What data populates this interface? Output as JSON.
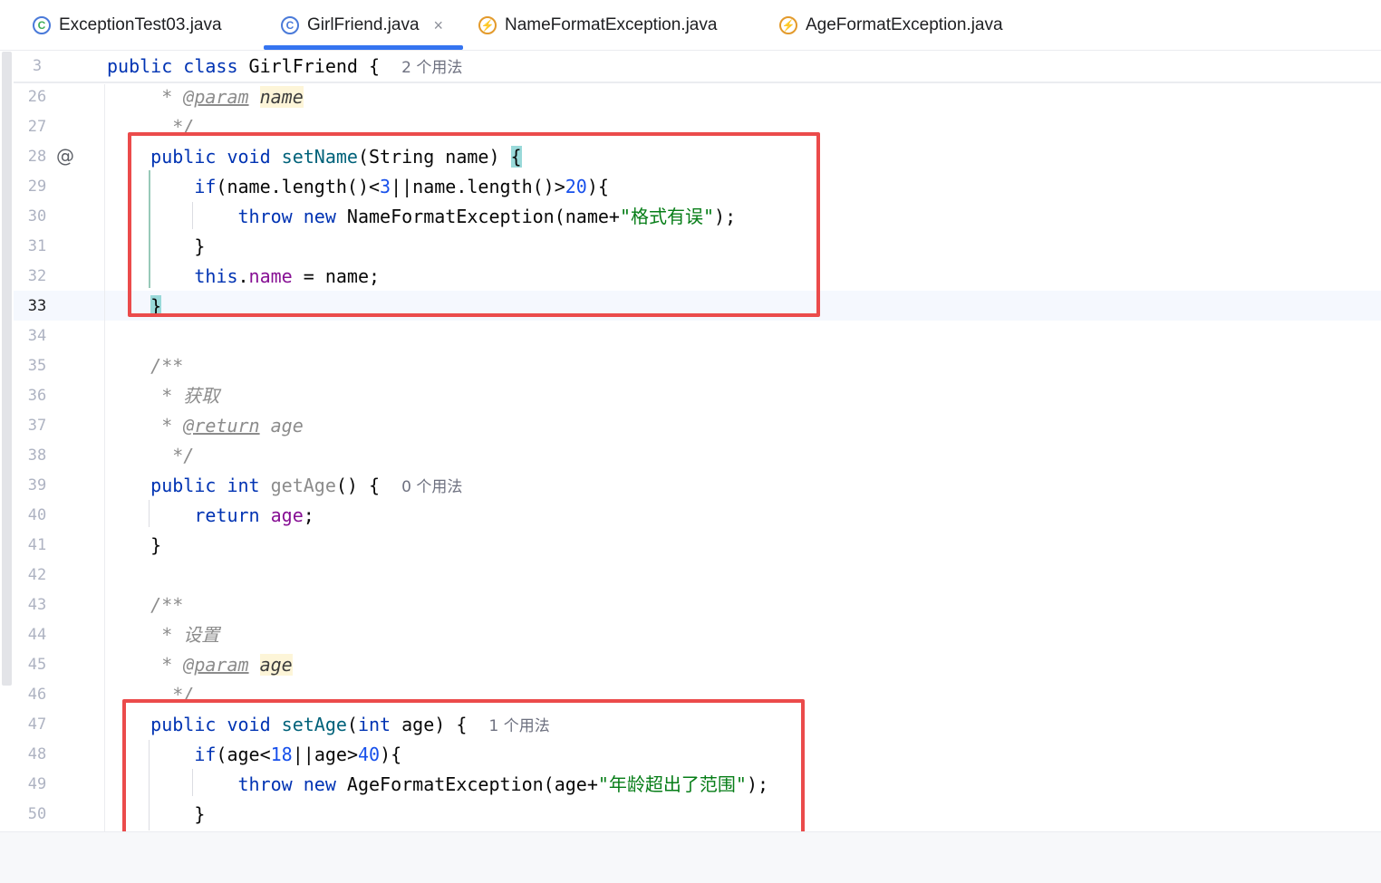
{
  "tabs": [
    {
      "label": "ExceptionTest03.java",
      "icon": "run-class-icon",
      "glyph": "C",
      "active": false
    },
    {
      "label": "GirlFriend.java",
      "icon": "class-icon",
      "glyph": "C",
      "active": true,
      "close": "×"
    },
    {
      "label": "NameFormatException.java",
      "icon": "exception-class-icon",
      "glyph": "⚡",
      "active": false
    },
    {
      "label": "AgeFormatException.java",
      "icon": "exception-class-icon",
      "glyph": "⚡",
      "active": false
    }
  ],
  "gutter_icon": "@",
  "current_line": "33",
  "sticky_line": {
    "num": "3",
    "tokens": [
      [
        "kw",
        "public class "
      ],
      [
        "",
        "GirlFriend {  "
      ],
      [
        "hint",
        "2 个用法"
      ]
    ]
  },
  "lines": [
    {
      "num": "26",
      "tokens": [
        [
          "",
          "    "
        ],
        [
          "cmt",
          " * "
        ],
        [
          "tag",
          "@param"
        ],
        [
          "cmt",
          " "
        ],
        [
          "pp",
          "name"
        ]
      ]
    },
    {
      "num": "27",
      "tokens": [
        [
          "",
          "    "
        ],
        [
          "cmt",
          "  */"
        ]
      ]
    },
    {
      "num": "28",
      "tokens": [
        [
          "",
          "    "
        ],
        [
          "kw",
          "public void "
        ],
        [
          "fn",
          "setName"
        ],
        [
          "",
          "(String name) "
        ],
        [
          "brace",
          "{"
        ]
      ]
    },
    {
      "num": "29",
      "tokens": [
        [
          "",
          "        "
        ],
        [
          "kw",
          "if"
        ],
        [
          "",
          "(name.length()<"
        ],
        [
          "num",
          "3"
        ],
        [
          "",
          "||name.length()>"
        ],
        [
          "num",
          "20"
        ],
        [
          "",
          "){"
        ]
      ]
    },
    {
      "num": "30",
      "tokens": [
        [
          "",
          "            "
        ],
        [
          "kw",
          "throw new "
        ],
        [
          "",
          "NameFormatException(name+"
        ],
        [
          "str",
          "\"格式有误\""
        ],
        [
          "",
          ");"
        ]
      ]
    },
    {
      "num": "31",
      "tokens": [
        [
          "",
          "        }"
        ]
      ]
    },
    {
      "num": "32",
      "tokens": [
        [
          "",
          "        "
        ],
        [
          "kw",
          "this"
        ],
        [
          "",
          "."
        ],
        [
          "fld",
          "name"
        ],
        [
          "",
          " = name;"
        ]
      ]
    },
    {
      "num": "33",
      "tokens": [
        [
          "",
          "    "
        ],
        [
          "brace",
          "}"
        ]
      ]
    },
    {
      "num": "34",
      "tokens": []
    },
    {
      "num": "35",
      "tokens": [
        [
          "",
          "    "
        ],
        [
          "cmt",
          "/**"
        ]
      ]
    },
    {
      "num": "36",
      "tokens": [
        [
          "",
          "    "
        ],
        [
          "cmt",
          " * 获取"
        ]
      ]
    },
    {
      "num": "37",
      "tokens": [
        [
          "",
          "    "
        ],
        [
          "cmt",
          " * "
        ],
        [
          "tag",
          "@return"
        ],
        [
          "cmt",
          " age"
        ]
      ]
    },
    {
      "num": "38",
      "tokens": [
        [
          "",
          "    "
        ],
        [
          "cmt",
          "  */"
        ]
      ]
    },
    {
      "num": "39",
      "tokens": [
        [
          "",
          "    "
        ],
        [
          "kw",
          "public int "
        ],
        [
          "dim",
          "getAge"
        ],
        [
          "",
          "() {  "
        ],
        [
          "hint",
          "0 个用法"
        ]
      ]
    },
    {
      "num": "40",
      "tokens": [
        [
          "",
          "        "
        ],
        [
          "kw",
          "return "
        ],
        [
          "fld",
          "age"
        ],
        [
          "",
          ";"
        ]
      ]
    },
    {
      "num": "41",
      "tokens": [
        [
          "",
          "    }"
        ]
      ]
    },
    {
      "num": "42",
      "tokens": []
    },
    {
      "num": "43",
      "tokens": [
        [
          "",
          "    "
        ],
        [
          "cmt",
          "/**"
        ]
      ]
    },
    {
      "num": "44",
      "tokens": [
        [
          "",
          "    "
        ],
        [
          "cmt",
          " * 设置"
        ]
      ]
    },
    {
      "num": "45",
      "tokens": [
        [
          "",
          "    "
        ],
        [
          "cmt",
          " * "
        ],
        [
          "tag",
          "@param"
        ],
        [
          "cmt",
          " "
        ],
        [
          "pp",
          "age"
        ]
      ]
    },
    {
      "num": "46",
      "tokens": [
        [
          "",
          "    "
        ],
        [
          "cmt",
          "  */"
        ]
      ]
    },
    {
      "num": "47",
      "tokens": [
        [
          "",
          "    "
        ],
        [
          "kw",
          "public void "
        ],
        [
          "fn",
          "setAge"
        ],
        [
          "",
          "("
        ],
        [
          "kw",
          "int"
        ],
        [
          "",
          " age) {  "
        ],
        [
          "hint",
          "1 个用法"
        ]
      ]
    },
    {
      "num": "48",
      "tokens": [
        [
          "",
          "        "
        ],
        [
          "kw",
          "if"
        ],
        [
          "",
          "(age<"
        ],
        [
          "num",
          "18"
        ],
        [
          "",
          "||age>"
        ],
        [
          "num",
          "40"
        ],
        [
          "",
          "){"
        ]
      ]
    },
    {
      "num": "49",
      "tokens": [
        [
          "",
          "            "
        ],
        [
          "kw",
          "throw new "
        ],
        [
          "",
          "AgeFormatException(age+"
        ],
        [
          "str",
          "\"年龄超出了范围\""
        ],
        [
          "",
          ");"
        ]
      ]
    },
    {
      "num": "50",
      "tokens": [
        [
          "",
          "        }"
        ]
      ]
    }
  ]
}
